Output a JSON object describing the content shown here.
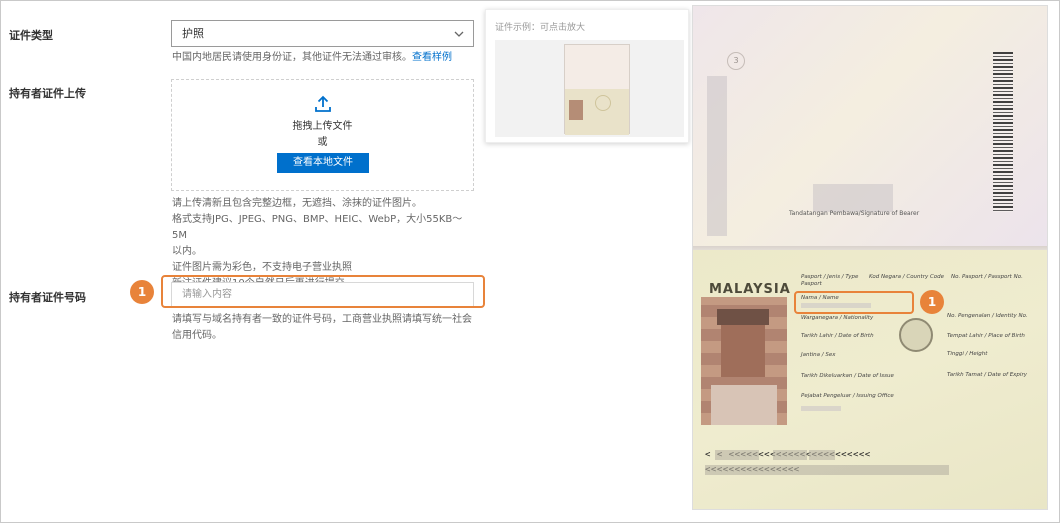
{
  "form": {
    "id_type_label": "证件类型",
    "id_type_value": "护照",
    "id_type_hint": "中国内地居民请使用身份证，其他证件无法通过审核。",
    "id_type_hint_link": "查看样例",
    "upload_label": "持有者证件上传",
    "upload_drag_text": "拖拽上传文件",
    "upload_or_text": "或",
    "upload_button": "查看本地文件",
    "upload_hints": [
      "请上传清新且包含完整边框，无遮挡、涂抹的证件图片。",
      "格式支持JPG、JPEG、PNG、BMP、HEIC、WebP，大小55KB～5M",
      "以内。",
      "证件图片需为彩色，不支持电子营业执照",
      "新注证件建议10个自然日后再进行提交"
    ],
    "id_number_label": "持有者证件号码",
    "id_number_placeholder": "请输入内容",
    "id_number_hint": "请填写与域名持有者一致的证件号码，工商营业执照请填写统一社会信用代码。"
  },
  "example": {
    "title": "证件示例：可点击放大"
  },
  "badges": {
    "form_badge": "1",
    "passport_badge": "1"
  },
  "passport": {
    "page_number": "3",
    "signature_label": "Tandatangan Pembawa/Signature of Bearer",
    "country": "MALAYSIA",
    "fields": {
      "passport_type": "Pasport / Jenis / Type",
      "country_code": "Kod Negara / Country Code",
      "passport_no": "No. Pasport / Passport No.",
      "passport_word": "Pasport",
      "name": "Nama / Name",
      "nationality": "Warganegara / Nationality",
      "id_no": "No. Pengenalan / Identity No.",
      "dob": "Tarikh Lahir / Date of Birth",
      "pob": "Tempat Lahir / Place of Birth",
      "sex": "Jantina / Sex",
      "height": "Tinggi / Height",
      "issue_date": "Tarikh Dikeluarkan / Date of Issue",
      "expiry_date": "Tarikh Tamat / Date of Expiry",
      "issuing_office": "Pejabat Pengeluar / Issuing Office"
    },
    "mrz_line1": "<                <                <<<<<<<<<<<<<<<<<<<<<<<<",
    "mrz_line2": "                                          <<<<<<<<<<<<<<<<"
  },
  "colors": {
    "accent_blue": "#0070cc",
    "highlight_orange": "#e8833a"
  }
}
